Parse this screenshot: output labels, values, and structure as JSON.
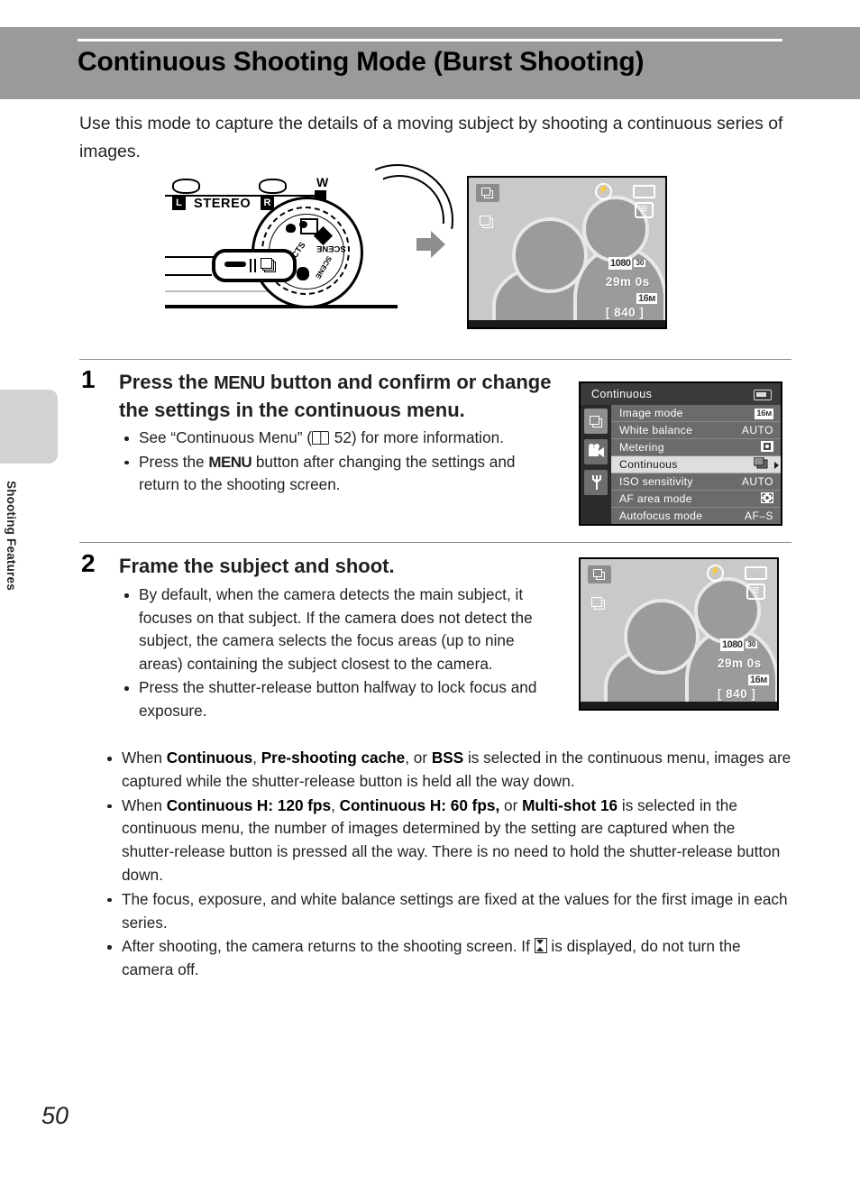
{
  "header": {
    "title": "Continuous Shooting Mode (Burst Shooting)"
  },
  "sidebar": {
    "section_label": "Shooting Features"
  },
  "intro": {
    "text": "Use this mode to capture the details of a moving subject by shooting a continuous series of images."
  },
  "illustration": {
    "mic_left_label": "L",
    "stereo_label": "STEREO",
    "mic_right_label": "R",
    "wide_label": "W",
    "dial_scene_label": "SCENE",
    "dial_scene_auto_label": "SCENE",
    "dial_effects_label": "EFFECTS",
    "arrow": "right-arrow-icon"
  },
  "lcd_top": {
    "mode_badge": "continuous-mode-icon",
    "burst_icon": "burst-icon",
    "flash_icon": "flash-off-icon",
    "battery_icon": "battery-icon",
    "vr_icon": "vibration-reduction-icon",
    "movie_size": "1080",
    "movie_fps": "30",
    "record_time": "29m 0s",
    "image_size": "16м",
    "shots_remaining": "[ 840 ]"
  },
  "steps": [
    {
      "number": "1",
      "heading_before": "Press the ",
      "heading_menu": "MENU",
      "heading_after": " button and confirm or change the settings in the continuous menu.",
      "bullets": [
        {
          "pre": "See “Continuous Menu” (",
          "icon": "book-icon",
          "page": " 52) for more information.",
          "post": ""
        },
        {
          "pre": "Press the ",
          "menu": "MENU",
          "post": " button after changing the settings and return to the shooting screen."
        }
      ]
    },
    {
      "number": "2",
      "heading": "Frame the subject and shoot.",
      "bullets": [
        "By default, when the camera detects the main subject, it focuses on that subject. If the camera does not detect the subject, the camera selects the focus areas (up to nine areas) containing the subject closest to the camera.",
        "Press the shutter-release button halfway to lock focus and exposure."
      ]
    }
  ],
  "menu_screen": {
    "title": "Continuous",
    "battery_icon": "battery-icon",
    "tabs": [
      {
        "name": "shooting-tab",
        "selected": true
      },
      {
        "name": "movie-tab",
        "selected": false
      },
      {
        "name": "setup-tab",
        "selected": false
      }
    ],
    "rows": [
      {
        "label": "Image mode",
        "value": "16м",
        "value_type": "badge",
        "selected": false
      },
      {
        "label": "White balance",
        "value": "AUTO",
        "value_type": "text",
        "selected": false
      },
      {
        "label": "Metering",
        "value": "metering-icon",
        "value_type": "icon",
        "selected": false
      },
      {
        "label": "Continuous",
        "value": "burst-icon",
        "value_type": "icon",
        "selected": true
      },
      {
        "label": "ISO sensitivity",
        "value": "AUTO",
        "value_type": "text",
        "selected": false
      },
      {
        "label": "AF area mode",
        "value": "af-area-icon",
        "value_type": "icon",
        "selected": false
      },
      {
        "label": "Autofocus mode",
        "value": "AF–S",
        "value_type": "text",
        "selected": false
      }
    ]
  },
  "lcd_bottom": {
    "mode_badge": "continuous-mode-icon",
    "burst_icon": "burst-icon",
    "flash_icon": "flash-off-icon",
    "battery_icon": "battery-icon",
    "vr_icon": "vibration-reduction-icon",
    "movie_size": "1080",
    "movie_fps": "30",
    "record_time": "29m 0s",
    "image_size": "16м",
    "shots_remaining": "[ 840 ]"
  },
  "bottom_bullets": [
    {
      "parts": [
        {
          "t": "When ",
          "b": false
        },
        {
          "t": "Continuous",
          "b": true
        },
        {
          "t": ", ",
          "b": false
        },
        {
          "t": "Pre-shooting cache",
          "b": true
        },
        {
          "t": ", or ",
          "b": false
        },
        {
          "t": "BSS",
          "b": true
        },
        {
          "t": " is selected in the continuous menu, images are captured while the shutter-release button is held all the way down.",
          "b": false
        }
      ]
    },
    {
      "parts": [
        {
          "t": "When ",
          "b": false
        },
        {
          "t": "Continuous H: 120 fps",
          "b": true
        },
        {
          "t": ", ",
          "b": false
        },
        {
          "t": "Continuous H: 60 fps,",
          "b": true
        },
        {
          "t": " or ",
          "b": false
        },
        {
          "t": "Multi-shot 16",
          "b": true
        },
        {
          "t": " is selected in the continuous menu, the number of images determined by the setting are captured when the shutter-release button is pressed all the way. There is no need to hold the shutter-release button down.",
          "b": false
        }
      ]
    },
    {
      "parts": [
        {
          "t": "The focus, exposure, and white balance settings are fixed at the values for the first image in each series.",
          "b": false
        }
      ]
    },
    {
      "parts": [
        {
          "t": "After shooting, the camera returns to the shooting screen. If ",
          "b": false
        },
        {
          "t": "__HOURGLASS__",
          "b": false
        },
        {
          "t": " is displayed, do not turn the camera off.",
          "b": false
        }
      ]
    }
  ],
  "footer": {
    "page_number": "50"
  },
  "colors": {
    "header_band": "#9a9a9a",
    "side_tab": "#d2d2d2",
    "lcd_bg": "#c9c9c9",
    "lcd_person": "#9b9b9b",
    "menu_bg": "#6b6b6b",
    "menu_title_bg": "#3a3a3a",
    "menu_selected": "#dedede",
    "text": "#231f20"
  }
}
